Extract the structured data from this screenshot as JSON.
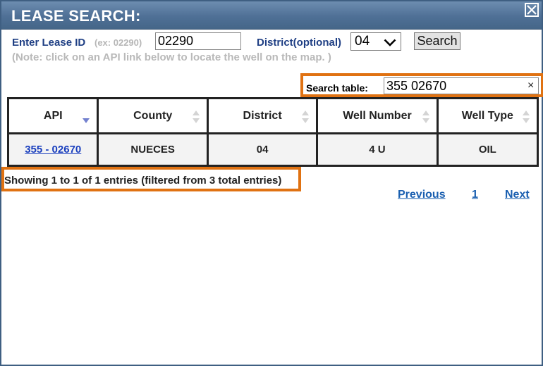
{
  "dialog": {
    "title": "LEASE SEARCH:",
    "close_icon": "close-icon"
  },
  "form": {
    "lease_label": "Enter Lease ID",
    "lease_hint": "(ex: 02290)",
    "lease_value": "02290",
    "district_label": "District(optional)",
    "district_value": "04",
    "search_label": "Search",
    "note": "(Note: click on an API link below to locate the well on the map. )"
  },
  "table_search": {
    "label": "Search table:",
    "value": "355 02670",
    "clear": "×"
  },
  "table": {
    "columns": [
      "API",
      "County",
      "District",
      "Well Number",
      "Well Type"
    ],
    "rows": [
      {
        "api": "355 - 02670",
        "county": "NUECES",
        "district": "04",
        "well_number": "4 U",
        "well_type": "OIL"
      }
    ]
  },
  "info": "Showing 1 to 1 of 1 entries (filtered from 3 total entries)",
  "pager": {
    "previous": "Previous",
    "page": "1",
    "next": "Next"
  },
  "colors": {
    "title_bar": "#4f7096",
    "highlight": "#e07212",
    "link": "#1a3fbe",
    "label": "#1f3f84"
  }
}
